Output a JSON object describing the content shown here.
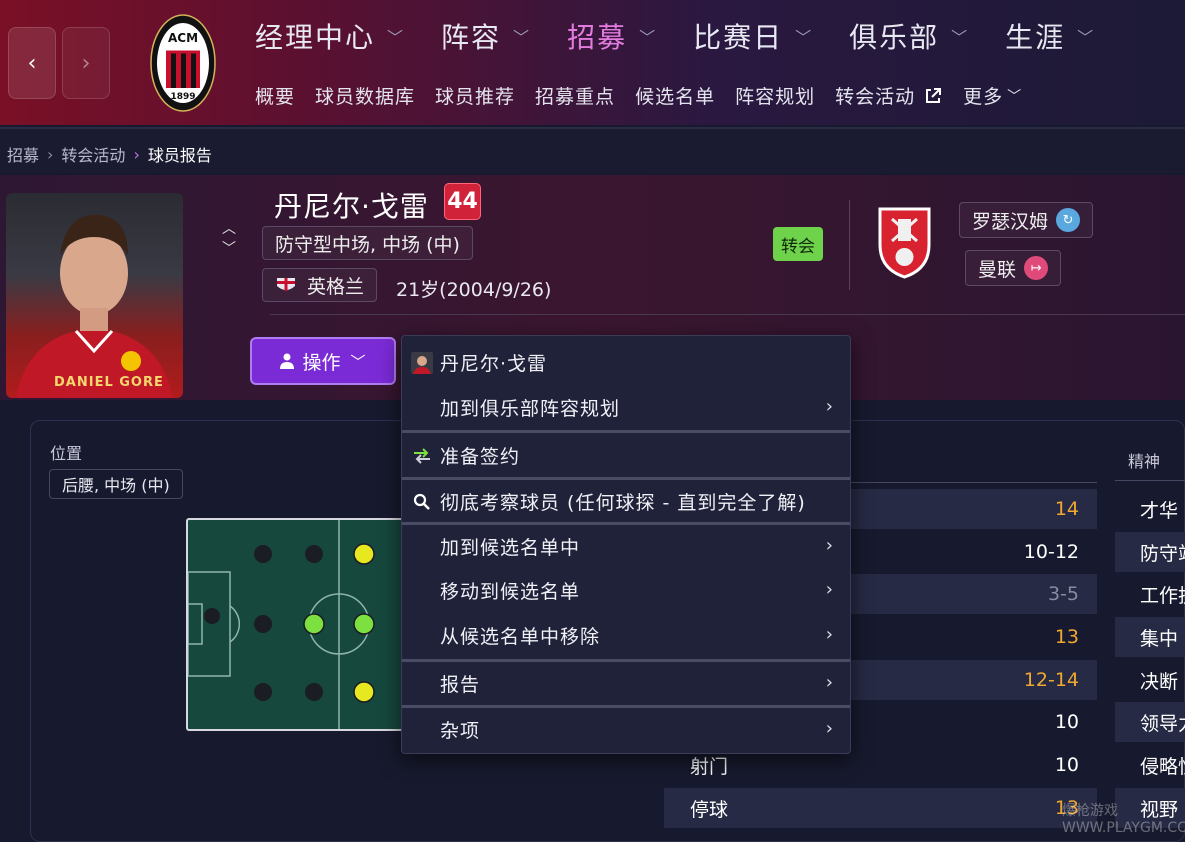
{
  "nav": {
    "back": "‹",
    "forward": "›",
    "main": [
      {
        "label": "经理中心",
        "active": false
      },
      {
        "label": "阵容",
        "active": false
      },
      {
        "label": "招募",
        "active": true
      },
      {
        "label": "比赛日",
        "active": false
      },
      {
        "label": "俱乐部",
        "active": false
      },
      {
        "label": "生涯",
        "active": false
      }
    ],
    "sub": [
      "概要",
      "球员数据库",
      "球员推荐",
      "招募重点",
      "候选名单",
      "阵容规划",
      "转会活动",
      "更多"
    ]
  },
  "breadcrumb": [
    "招募",
    "转会活动",
    "球员报告"
  ],
  "player": {
    "name": "丹尼尔·戈雷",
    "number": "44",
    "position": "防守型中场, 中场 (中)",
    "nation": "英格兰",
    "age": "21岁(2004/9/26)",
    "status": "转会",
    "club": "罗瑟汉姆",
    "league": "曼联",
    "photo_text": "DANIEL GORE"
  },
  "action_button": "操作",
  "positions": {
    "label": "位置",
    "value": "后腰, 中场 (中)"
  },
  "context_menu": {
    "header": "丹尼尔·戈雷",
    "items": [
      {
        "label": "加到俱乐部阵容规划",
        "submenu": true
      },
      {
        "label": "准备签约",
        "submenu": false,
        "icon": "sign-icon"
      },
      {
        "label": "彻底考察球员 (任何球探 - 直到完全了解)",
        "submenu": false,
        "icon": "search-icon"
      },
      {
        "label": "加到候选名单中",
        "submenu": true
      },
      {
        "label": "移动到候选名单",
        "submenu": true
      },
      {
        "label": "从候选名单中移除",
        "submenu": true
      },
      {
        "label": "报告",
        "submenu": true
      },
      {
        "label": "杂项",
        "submenu": true
      }
    ]
  },
  "attributes": [
    {
      "name": "",
      "value": "14",
      "color": "#f0a830"
    },
    {
      "name": "",
      "value": "10-12",
      "color": "#ffffff"
    },
    {
      "name": "",
      "value": "3-5",
      "color": "#8a8aa0"
    },
    {
      "name": "",
      "value": "13",
      "color": "#f0a830"
    },
    {
      "name": "",
      "value": "12-14",
      "color": "#f0a830"
    },
    {
      "name": "",
      "value": "10",
      "color": "#ffffff"
    },
    {
      "name": "射门",
      "value": "10",
      "color": "#ffffff"
    },
    {
      "name": "停球",
      "value": "13",
      "color": "#f0a830"
    }
  ],
  "mental": {
    "header": "精神",
    "items": [
      "才华",
      "防守站位",
      "工作投入",
      "集中",
      "决断",
      "领导力",
      "侵略性",
      "视野"
    ]
  },
  "watermark": "爆枪游戏 WWW.PLAYGM.CC",
  "colors": {
    "accent": "#7b2bd6",
    "active_nav": "#e27bde",
    "highlight": "#f0a830"
  }
}
